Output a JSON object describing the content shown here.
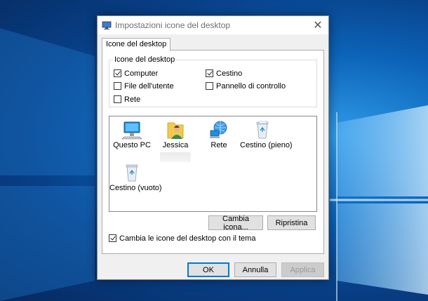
{
  "window": {
    "title": "Impostazioni icone del desktop",
    "close_glyph": "✕",
    "icon": "desktop-settings-icon"
  },
  "tabs": [
    {
      "label": "Icone del desktop",
      "active": true
    }
  ],
  "desktop_icons_group": {
    "title": "Icone del desktop",
    "checkboxes": [
      {
        "label": "Computer",
        "checked": true
      },
      {
        "label": "Cestino",
        "checked": true
      },
      {
        "label": "File dell'utente",
        "checked": false
      },
      {
        "label": "Pannello di controllo",
        "checked": false
      },
      {
        "label": "Rete",
        "checked": false
      }
    ]
  },
  "icon_list": {
    "items": [
      {
        "label": "Questo PC",
        "icon": "computer-icon"
      },
      {
        "label": "Jessica",
        "icon": "user-folder-icon"
      },
      {
        "label": "Rete",
        "icon": "network-icon"
      },
      {
        "label": "Cestino (pieno)",
        "icon": "recycle-bin-full-icon"
      },
      {
        "label": "Cestino (vuoto)",
        "icon": "recycle-bin-empty-icon"
      }
    ]
  },
  "actions": {
    "change_icon": "Cambia icona...",
    "restore": "Ripristina"
  },
  "theme_option": {
    "label": "Cambia le icone del desktop con il tema",
    "checked": true
  },
  "footer": {
    "ok": "OK",
    "cancel": "Annulla",
    "apply": "Applica",
    "apply_enabled": false
  },
  "colors": {
    "accent": "#0078d7",
    "desktop_blue": "#0c63b8"
  }
}
